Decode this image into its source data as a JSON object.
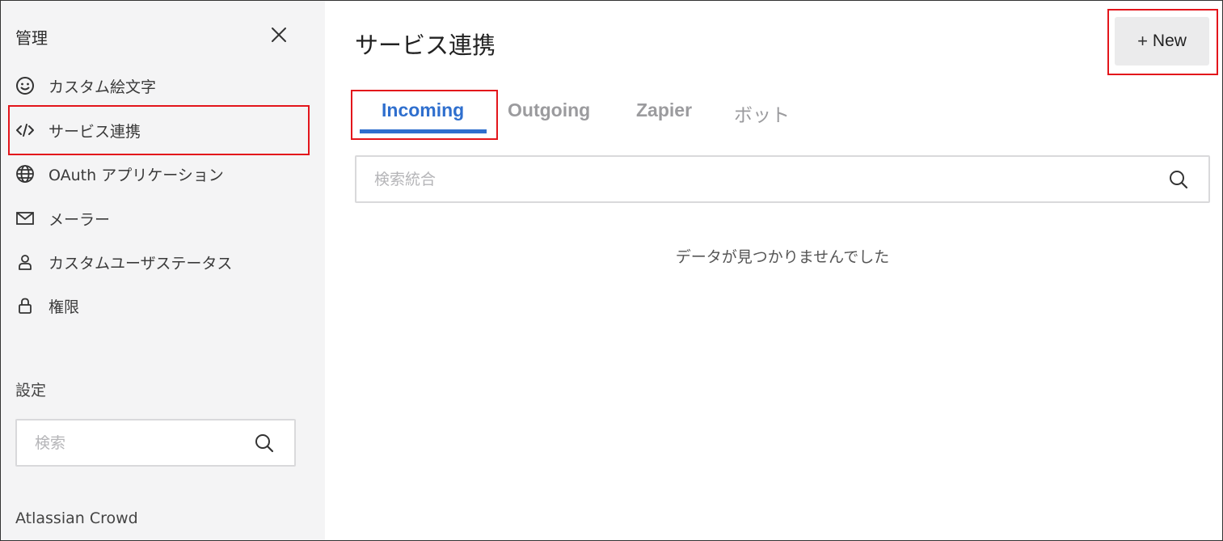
{
  "sidebar": {
    "title": "管理",
    "close_icon": "close-icon",
    "items": [
      {
        "label": "カスタム絵文字",
        "icon": "smiley-icon"
      },
      {
        "label": "サービス連携",
        "icon": "code-icon"
      },
      {
        "label": "OAuth アプリケーション",
        "icon": "globe-icon"
      },
      {
        "label": "メーラー",
        "icon": "mail-icon"
      },
      {
        "label": "カスタムユーザステータス",
        "icon": "user-icon"
      },
      {
        "label": "権限",
        "icon": "lock-icon"
      }
    ],
    "settings_label": "設定",
    "search": {
      "placeholder": "検索",
      "value": ""
    },
    "footer_item": "Atlassian Crowd"
  },
  "main": {
    "title": "サービス連携",
    "new_button": {
      "plus": "+",
      "label": "New"
    },
    "tabs": [
      {
        "label": "Incoming",
        "active": true
      },
      {
        "label": "Outgoing",
        "active": false
      },
      {
        "label": "Zapier",
        "active": false
      },
      {
        "label": "ボット",
        "active": false
      }
    ],
    "search": {
      "placeholder": "検索統合",
      "value": ""
    },
    "empty_message": "データが見つかりませんでした"
  },
  "colors": {
    "accent": "#2f6fce",
    "highlight": "#e3151b",
    "sidebar_bg": "#f4f4f5"
  }
}
